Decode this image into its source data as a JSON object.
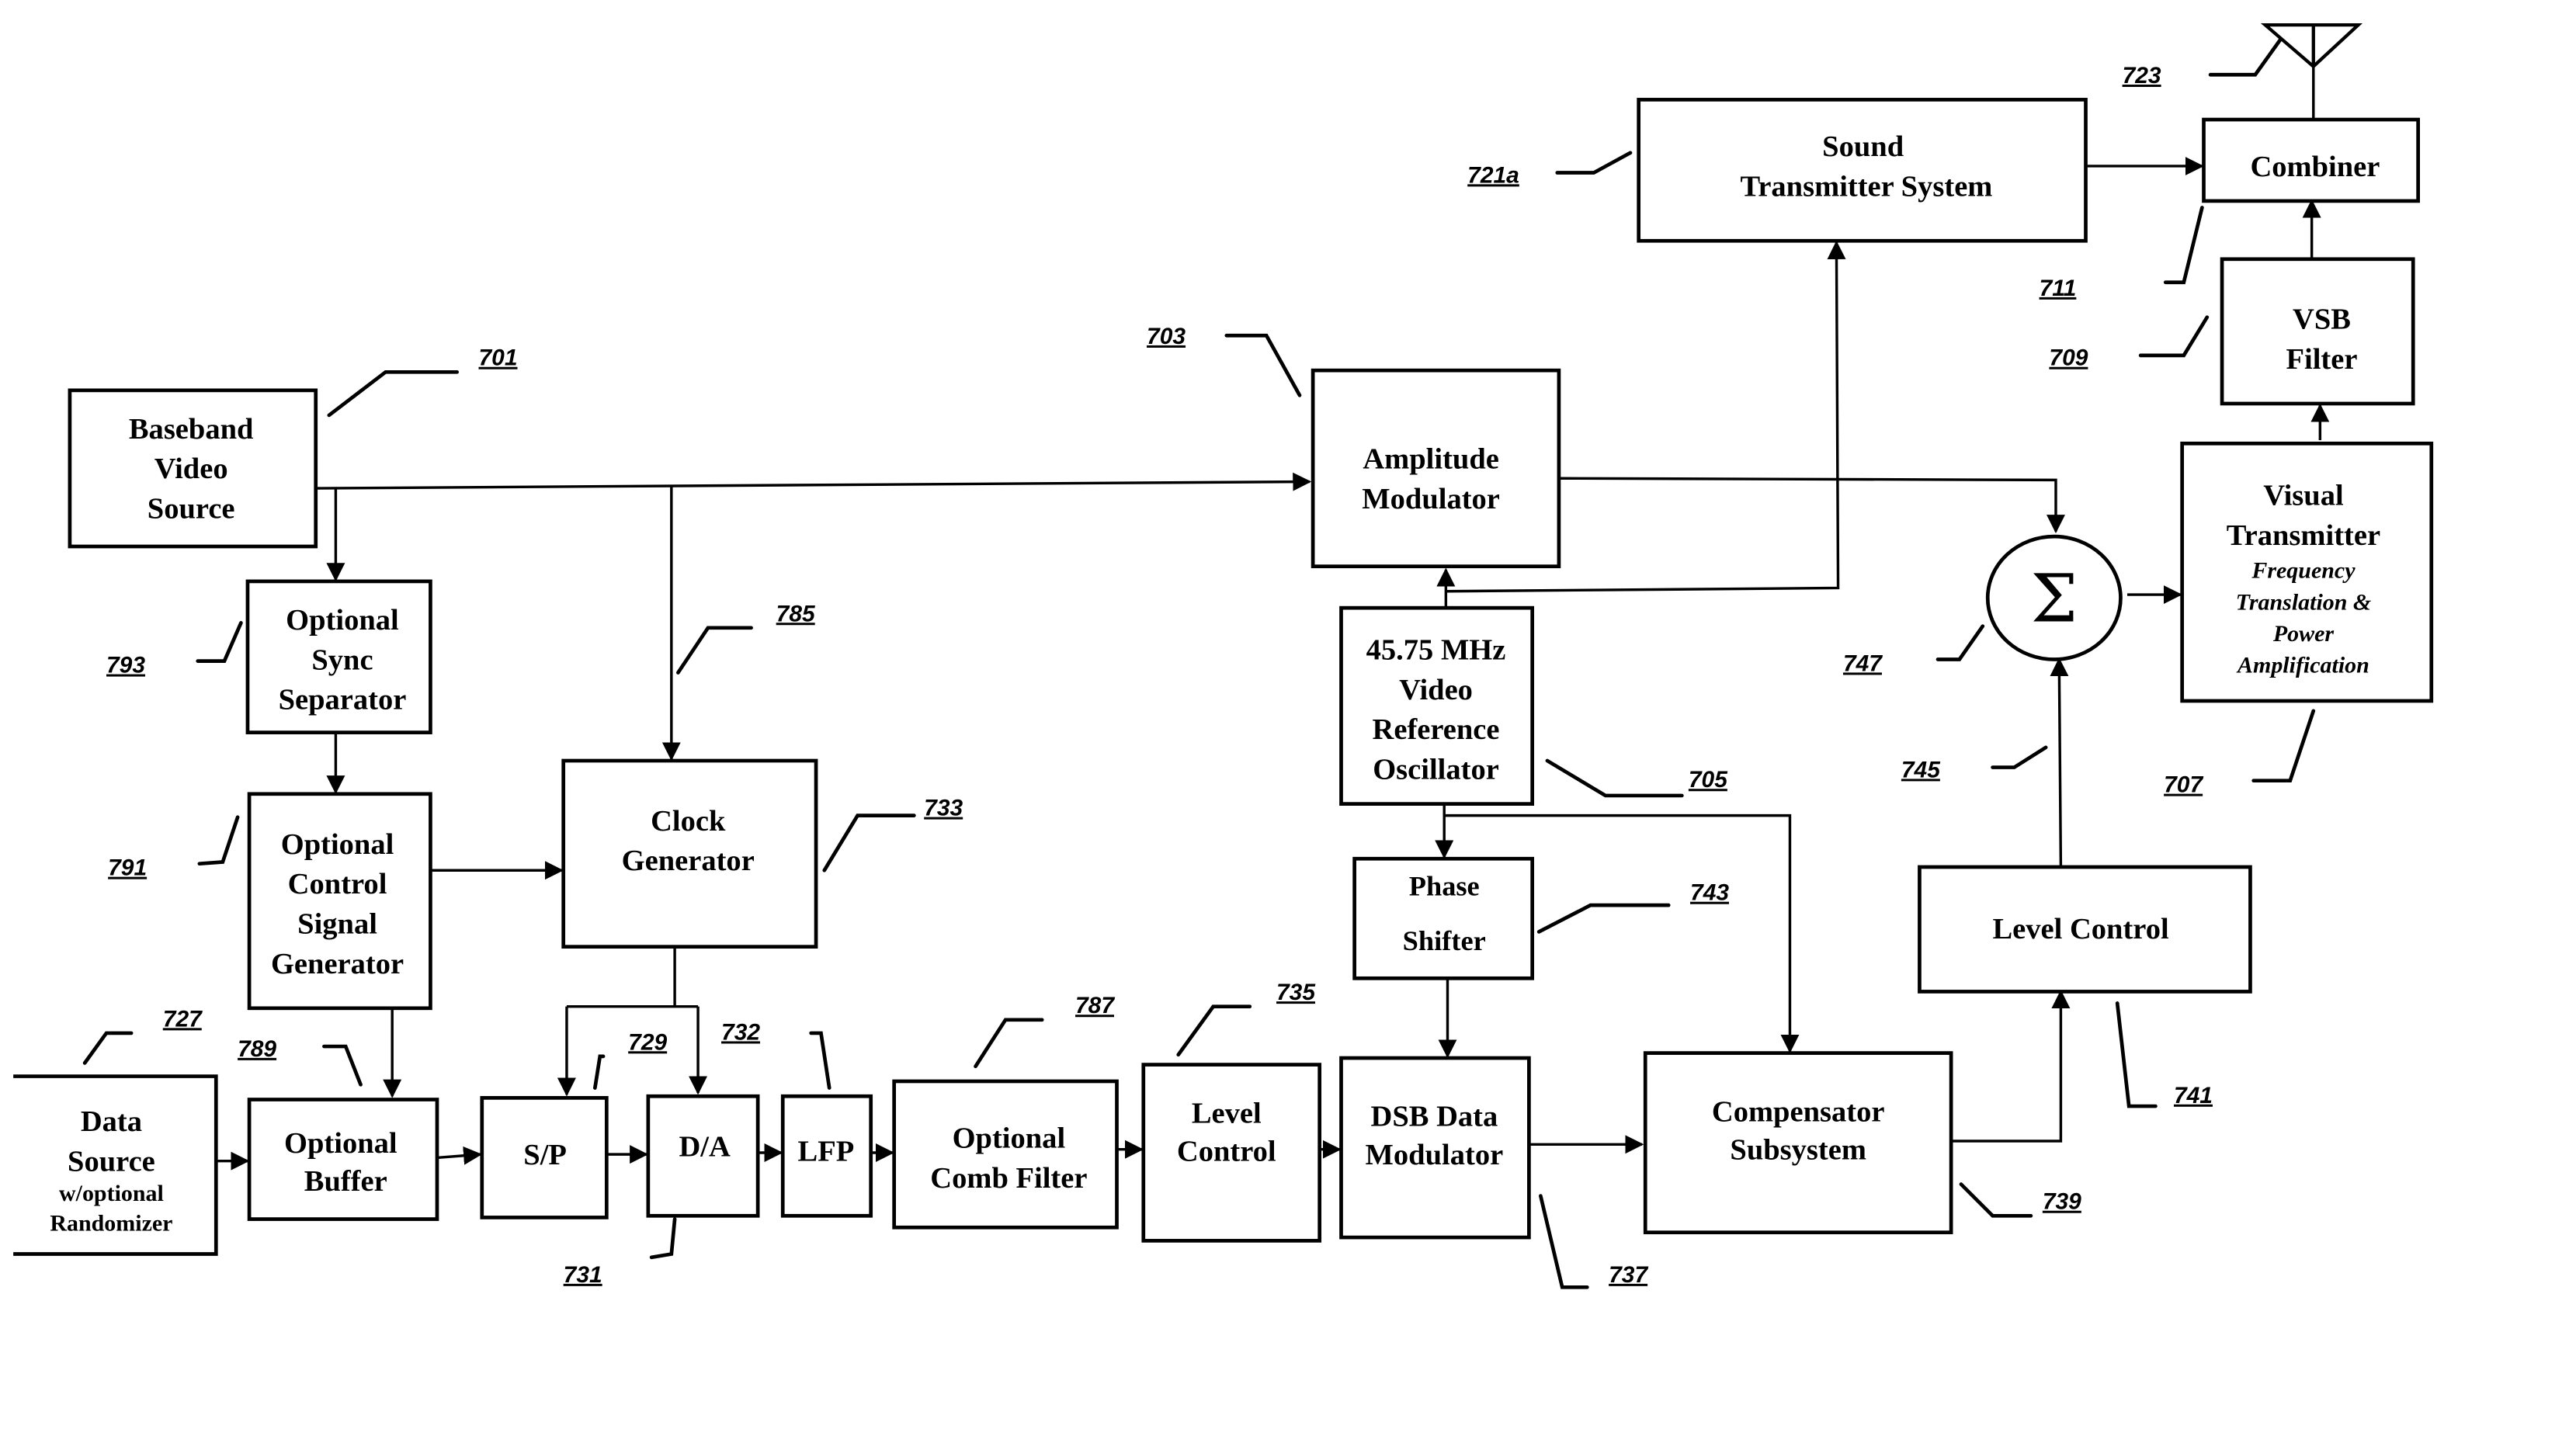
{
  "figure": {
    "blocks": {
      "baseband_video_source": {
        "lines": [
          "Baseband",
          "Video",
          "Source"
        ],
        "ref": "701"
      },
      "amplitude_modulator": {
        "lines": [
          "Amplitude",
          "Modulator"
        ],
        "ref": "703"
      },
      "video_reference_oscillator": {
        "lines": [
          "45.75 MHz",
          "Video",
          "Reference",
          "Oscillator"
        ],
        "ref": "705"
      },
      "visual_transmitter": {
        "lines": [
          "Visual",
          "Transmitter"
        ],
        "sublines": [
          "Frequency",
          "Translation &",
          "Power",
          "Amplification"
        ],
        "ref": "707"
      },
      "vsb_filter": {
        "lines": [
          "VSB",
          "Filter"
        ],
        "ref": "709"
      },
      "combiner": {
        "lines": [
          "Combiner"
        ],
        "ref": "711"
      },
      "sound_transmitter_system": {
        "lines": [
          "Sound",
          "Transmitter System"
        ],
        "ref": "721a"
      },
      "antenna": {
        "ref": "723"
      },
      "data_source": {
        "lines": [
          "Data",
          "Source"
        ],
        "sublines": [
          "w/optional",
          "Randomizer"
        ],
        "ref": "727"
      },
      "sp": {
        "lines": [
          "S/P"
        ],
        "ref": "729"
      },
      "da": {
        "lines": [
          "D/A"
        ],
        "ref": "731"
      },
      "lfp": {
        "lines": [
          "LFP"
        ],
        "ref": "732"
      },
      "clock_generator": {
        "lines": [
          "Clock",
          "Generator"
        ],
        "ref": "733"
      },
      "level_control_735": {
        "lines": [
          "Level",
          "Control"
        ],
        "ref": "735"
      },
      "dsb_data_modulator": {
        "lines": [
          "DSB Data",
          "Modulator"
        ],
        "ref": "737"
      },
      "compensator_subsystem": {
        "lines": [
          "Compensator",
          "Subsystem"
        ],
        "ref": "739"
      },
      "level_control_741": {
        "lines": [
          "Level Control"
        ],
        "ref": "741"
      },
      "phase_shifter": {
        "lines": [
          "Phase",
          "Shifter"
        ],
        "ref": "743"
      },
      "summer": {
        "symbol": "Σ",
        "ref": "747"
      },
      "summer_input": {
        "ref": "745"
      },
      "clock_line": {
        "ref": "785"
      },
      "optional_comb_filter": {
        "lines": [
          "Optional",
          "Comb Filter"
        ],
        "ref": "787"
      },
      "optional_buffer": {
        "lines": [
          "Optional",
          "Buffer"
        ],
        "ref": "789"
      },
      "optional_control_signal_generator": {
        "lines": [
          "Optional",
          "Control",
          "Signal",
          "Generator"
        ],
        "ref": "791"
      },
      "optional_sync_separator": {
        "lines": [
          "Optional",
          "Sync",
          "Separator"
        ],
        "ref": "793"
      }
    }
  }
}
